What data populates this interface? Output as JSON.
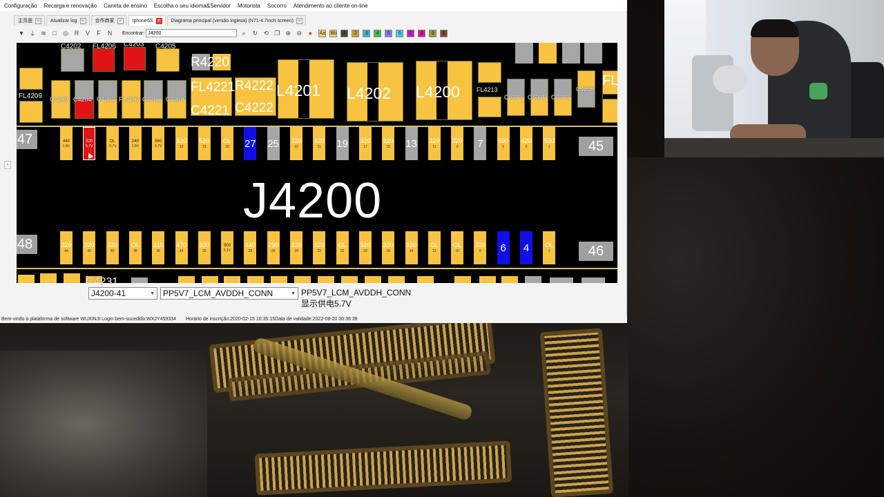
{
  "menu": [
    "Configuração",
    "Recarga e renovação",
    "Caneta de ensino",
    "Escolha o seu idioma&Servidor",
    "Motorista",
    "Socorro",
    "Atendimento ao cliente on-line"
  ],
  "tabs": [
    {
      "label": "主页面",
      "active": false
    },
    {
      "label": "Atualizar log",
      "active": false
    },
    {
      "label": "合作商家",
      "active": false
    },
    {
      "label": "Iphone6S",
      "active": true
    },
    {
      "label": "Diagrama principal (versão inglesa) (N71-4.7inch screen)",
      "active": false
    }
  ],
  "toolbar": {
    "find_label": "Encontrar:",
    "find_value": "J4200",
    "swatches": [
      "Aa",
      "Bb",
      "A",
      "2",
      "3",
      "4",
      "5",
      "6",
      "7",
      "8",
      "9",
      "B"
    ],
    "swatch_colors": [
      "#f0d060",
      "#f0d060",
      "#444444",
      "#c89a40",
      "#40b0d0",
      "#40c040",
      "#8080f0",
      "#40d0e0",
      "#c020c0",
      "#e010a0",
      "#90a030",
      "#805030"
    ]
  },
  "board": {
    "connector_title": "J4200",
    "labels": {
      "c4202": "C4202",
      "fl4206": "FL4206",
      "c4203": "C4203",
      "c4205": "C4205",
      "r4220": "R4220",
      "fl4209": "FL4209",
      "c4209": "C4209",
      "c4204": "C4204",
      "c4207": "C4207",
      "fl4207": "FL4207",
      "c4206": "C4206",
      "c4208": "C4208",
      "fl4221": "FL4221",
      "r4222": "R4222",
      "c4221": "C4221",
      "c4222": "C4222",
      "l4201": "L4201",
      "l4202": "L4202",
      "l4200": "L4200",
      "fl4213": "FL4213",
      "c4213": "C4213",
      "c4211": "C4211",
      "c4212": "C4212",
      "c4230": "C4230",
      "c4231": "C4231",
      "fl": "FL",
      "c4221b": "C4221",
      "c4230b": "C4230"
    },
    "end_left_top": "47",
    "end_right_top": "45",
    "end_left_bottom": "48",
    "end_right_bottom": "46",
    "top_pins": [
      {
        "v": "440",
        "n": "1.8V",
        "color": "yellow",
        "small": true
      },
      {
        "v": "320",
        "n": "5.7V",
        "color": "red",
        "small": true
      },
      {
        "v": "OL",
        "n": "-5.7V",
        "color": "yellow",
        "small": true
      },
      {
        "v": "240",
        "n": "1.8V",
        "color": "yellow",
        "small": true
      },
      {
        "v": "560",
        "n": "5.7V",
        "color": "yellow",
        "small": true
      },
      {
        "v": "320",
        "n": "33",
        "color": "yellow"
      },
      {
        "v": "520",
        "n": "31",
        "color": "yellow"
      },
      {
        "v": "OL",
        "n": "29",
        "color": "yellow"
      },
      {
        "v": "27",
        "n": "",
        "color": "blue",
        "big": true
      },
      {
        "v": "25",
        "n": "",
        "color": "gray",
        "big": true
      },
      {
        "v": "320",
        "n": "23",
        "color": "yellow"
      },
      {
        "v": "320",
        "n": "21",
        "color": "yellow"
      },
      {
        "v": "19",
        "n": "",
        "color": "gray",
        "big": true
      },
      {
        "v": "320",
        "n": "17",
        "color": "yellow"
      },
      {
        "v": "320",
        "n": "15",
        "color": "yellow"
      },
      {
        "v": "13",
        "n": "",
        "color": "gray",
        "big": true
      },
      {
        "v": "320",
        "n": "11",
        "color": "yellow"
      },
      {
        "v": "320",
        "n": "9",
        "color": "yellow"
      },
      {
        "v": "7",
        "n": "",
        "color": "gray",
        "big": true
      },
      {
        "v": "590",
        "n": "5",
        "color": "yellow"
      },
      {
        "v": "420",
        "n": "3",
        "color": "yellow"
      },
      {
        "v": "590",
        "n": "1",
        "color": "yellow"
      }
    ],
    "bottom_pins": [
      {
        "v": "320",
        "n": "44",
        "color": "yellow"
      },
      {
        "v": "320",
        "n": "42",
        "color": "yellow"
      },
      {
        "v": "320",
        "n": "40",
        "color": "yellow"
      },
      {
        "v": "OL",
        "n": "38",
        "color": "yellow"
      },
      {
        "v": "315",
        "n": "36",
        "color": "yellow"
      },
      {
        "v": "470",
        "n": "34",
        "color": "yellow"
      },
      {
        "v": "320",
        "n": "32",
        "color": "yellow"
      },
      {
        "v": "500",
        "n": "5.1V",
        "color": "yellow",
        "small": true
      },
      {
        "v": "440",
        "n": "28",
        "color": "yellow"
      },
      {
        "v": "290",
        "n": "26",
        "color": "yellow"
      },
      {
        "v": "320",
        "n": "24",
        "color": "yellow"
      },
      {
        "v": "320",
        "n": "22",
        "color": "yellow"
      },
      {
        "v": "OL",
        "n": "20",
        "color": "yellow"
      },
      {
        "v": "320",
        "n": "18",
        "color": "yellow"
      },
      {
        "v": "320",
        "n": "16",
        "color": "yellow"
      },
      {
        "v": "320",
        "n": "14",
        "color": "yellow"
      },
      {
        "v": "OL",
        "n": "12",
        "color": "yellow"
      },
      {
        "v": "OL",
        "n": "10",
        "color": "yellow"
      },
      {
        "v": "320",
        "n": "8",
        "color": "yellow"
      },
      {
        "v": "6",
        "n": "",
        "color": "blue",
        "big": true
      },
      {
        "v": "4",
        "n": "",
        "color": "blue",
        "big": true
      },
      {
        "v": "OL",
        "n": "2",
        "color": "yellow"
      }
    ]
  },
  "selection": {
    "pin_select": "J4200-41",
    "net_select": "PP5V7_LCM_AVDDH_CONN",
    "info_net": "PP5V7_LCM_AVDDH_CONN",
    "info_desc": "显示供电5.7V"
  },
  "status": {
    "welcome": "Bem-vindo à plataforma de software WUXINJI",
    "login": "Login bem-sucedido:WXJY459334",
    "times": "Horário de inscrição:2020-02-15 10:35:15Data de validade:2022-08-20 00:36:39"
  }
}
